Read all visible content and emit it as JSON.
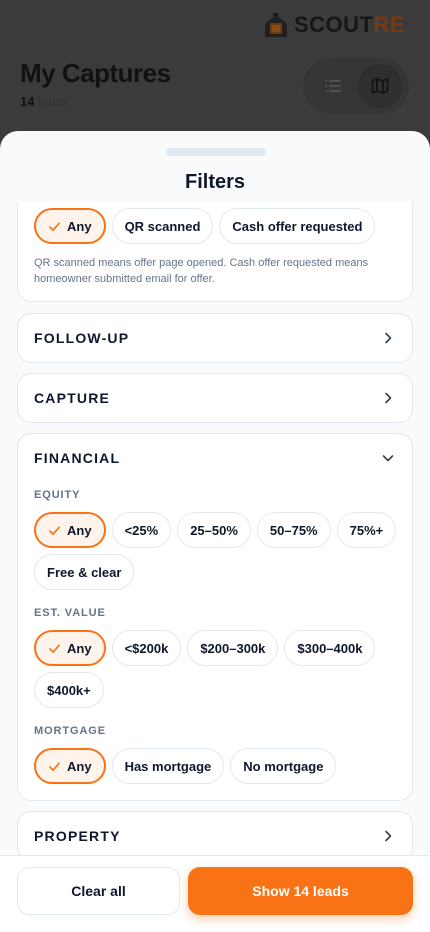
{
  "app": {
    "brand_main": "SCOUT",
    "brand_accent": "RE",
    "page_title": "My Captures",
    "lead_count": "14",
    "lead_count_suffix": " leads"
  },
  "sheet": {
    "title": "Filters",
    "status_section": {
      "chips": [
        {
          "label": "Any",
          "selected": true
        },
        {
          "label": "QR scanned",
          "selected": false
        },
        {
          "label": "Cash offer requested",
          "selected": false
        }
      ],
      "hint": "QR scanned means offer page opened. Cash offer requested means homeowner submitted email for offer."
    },
    "sections": {
      "follow_up": "FOLLOW-UP",
      "capture": "CAPTURE",
      "financial": "FINANCIAL",
      "property": "PROPERTY"
    },
    "financial": {
      "equity": {
        "label": "EQUITY",
        "chips": [
          "Any",
          "<25%",
          "25–50%",
          "50–75%",
          "75%+",
          "Free & clear"
        ]
      },
      "est_value": {
        "label": "EST. VALUE",
        "chips": [
          "Any",
          "<$200k",
          "$200–300k",
          "$300–400k",
          "$400k+"
        ]
      },
      "mortgage": {
        "label": "MORTGAGE",
        "chips": [
          "Any",
          "Has mortgage",
          "No mortgage"
        ]
      }
    }
  },
  "footer": {
    "clear_label": "Clear all",
    "show_label": "Show 14 leads"
  },
  "colors": {
    "accent": "#f97316",
    "selected_bg": "#fff4ec",
    "text": "#0f172a",
    "muted": "#64748b",
    "border": "#e2e8f0"
  }
}
